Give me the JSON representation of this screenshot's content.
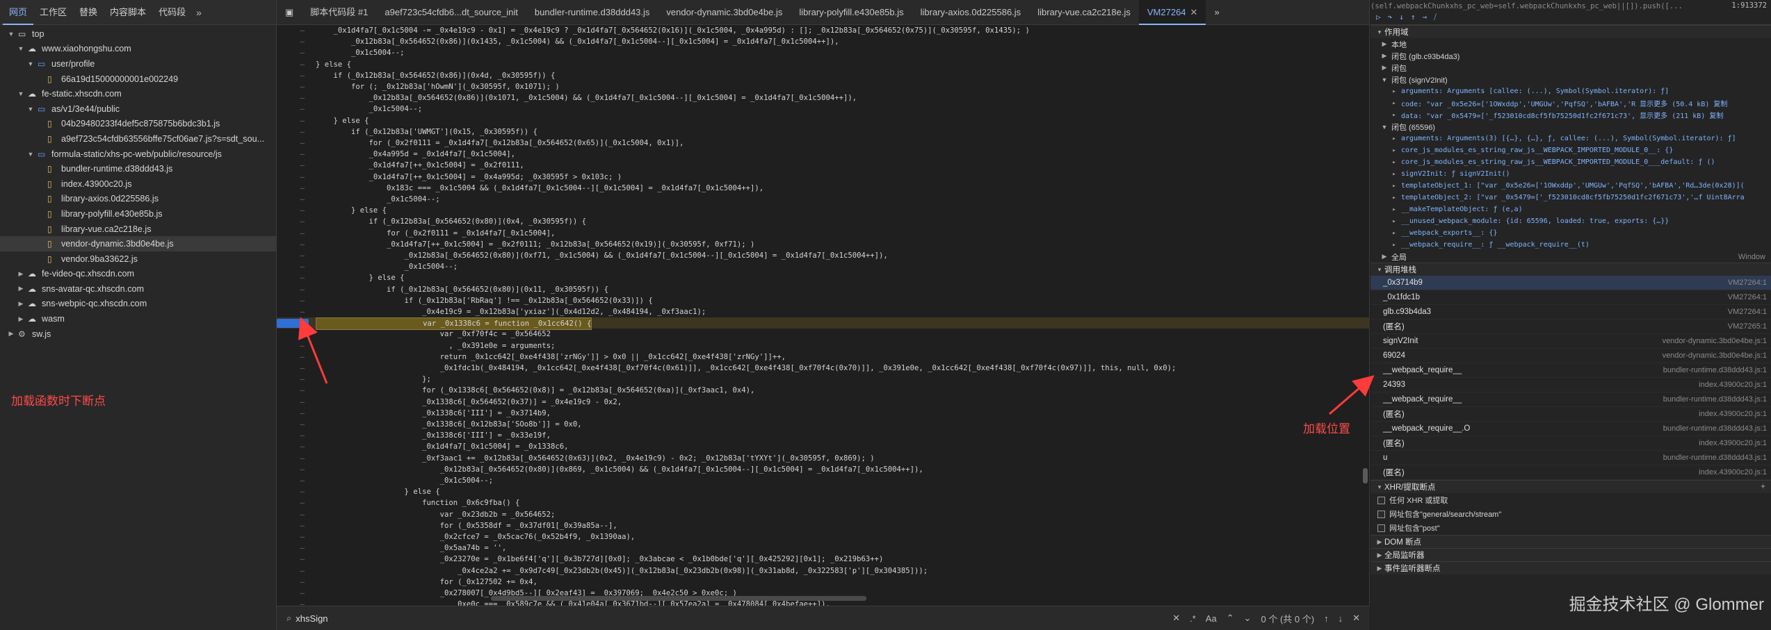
{
  "left": {
    "tabs": [
      "网页",
      "工作区",
      "替换",
      "内容脚本",
      "代码段"
    ],
    "active_tab": "网页",
    "tree": [
      {
        "label": "top",
        "depth": 0,
        "icon": "frame-icon",
        "expand": "down"
      },
      {
        "label": "www.xiaohongshu.com",
        "depth": 1,
        "icon": "cloud-icon",
        "expand": "down"
      },
      {
        "label": "user/profile",
        "depth": 2,
        "icon": "folder-icon",
        "expand": "down"
      },
      {
        "label": "66a19d15000000001e002249",
        "depth": 3,
        "icon": "file-icon",
        "expand": ""
      },
      {
        "label": "fe-static.xhscdn.com",
        "depth": 1,
        "icon": "cloud-icon",
        "expand": "down"
      },
      {
        "label": "as/v1/3e44/public",
        "depth": 2,
        "icon": "folder-icon",
        "expand": "down"
      },
      {
        "label": "04b29480233f4def5c875875b6bdc3b1.js",
        "depth": 3,
        "icon": "file-icon",
        "expand": ""
      },
      {
        "label": "a9ef723c54cfdb63556bffe75cf06ae7.js?s=sdt_sou...",
        "depth": 3,
        "icon": "file-icon",
        "expand": ""
      },
      {
        "label": "formula-static/xhs-pc-web/public/resource/js",
        "depth": 2,
        "icon": "folder-icon",
        "expand": "down"
      },
      {
        "label": "bundler-runtime.d38ddd43.js",
        "depth": 3,
        "icon": "file-icon",
        "expand": ""
      },
      {
        "label": "index.43900c20.js",
        "depth": 3,
        "icon": "file-icon",
        "expand": ""
      },
      {
        "label": "library-axios.0d225586.js",
        "depth": 3,
        "icon": "file-icon",
        "expand": ""
      },
      {
        "label": "library-polyfill.e430e85b.js",
        "depth": 3,
        "icon": "file-icon",
        "expand": ""
      },
      {
        "label": "library-vue.ca2c218e.js",
        "depth": 3,
        "icon": "file-icon",
        "expand": ""
      },
      {
        "label": "vendor-dynamic.3bd0e4be.js",
        "depth": 3,
        "icon": "file-icon",
        "expand": "",
        "selected": true
      },
      {
        "label": "vendor.9ba33622.js",
        "depth": 3,
        "icon": "file-icon",
        "expand": ""
      },
      {
        "label": "fe-video-qc.xhscdn.com",
        "depth": 1,
        "icon": "cloud-icon",
        "expand": "right"
      },
      {
        "label": "sns-avatar-qc.xhscdn.com",
        "depth": 1,
        "icon": "cloud-icon",
        "expand": "right"
      },
      {
        "label": "sns-webpic-qc.xhscdn.com",
        "depth": 1,
        "icon": "cloud-icon",
        "expand": "right"
      },
      {
        "label": "wasm",
        "depth": 1,
        "icon": "cloud-icon",
        "expand": "right"
      },
      {
        "label": "sw.js",
        "depth": 0,
        "icon": "gear-icon",
        "expand": "right"
      }
    ]
  },
  "editor": {
    "tabs": [
      {
        "label": "脚本代码段 #1",
        "active": false
      },
      {
        "label": "a9ef723c54cfdb6...dt_source_init",
        "active": false
      },
      {
        "label": "bundler-runtime.d38ddd43.js",
        "active": false
      },
      {
        "label": "vendor-dynamic.3bd0e4be.js",
        "active": false
      },
      {
        "label": "library-polyfill.e430e85b.js",
        "active": false
      },
      {
        "label": "library-axios.0d225586.js",
        "active": false
      },
      {
        "label": "library-vue.ca2c218e.js",
        "active": false
      },
      {
        "label": "VM27264",
        "active": true
      }
    ],
    "more_tabs": "»",
    "code": [
      "    _0x1d4fa7[_0x1c5004 -= _0x4e19c9 - 0x1] = _0x4e19c9 ? _0x1d4fa7[_0x564652(0x16)](_0x1c5004, _0x4a995d) : []; _0x12b83a[_0x564652(0x75)](_0x30595f, 0x1435); )",
      "        _0x12b83a[_0x564652(0x86)](0x1435, _0x1c5004) && (_0x1d4fa7[_0x1c5004--][_0x1c5004] = _0x1d4fa7[_0x1c5004++]),",
      "        _0x1c5004--;",
      "} else {",
      "    if (_0x12b83a[_0x564652(0x86)](0x4d, _0x30595f)) {",
      "        for (; _0x12b83a['hOwmN'](_0x30595f, 0x1071); )",
      "            _0x12b83a[_0x564652(0x86)](0x1071, _0x1c5004) && (_0x1d4fa7[_0x1c5004--][_0x1c5004] = _0x1d4fa7[_0x1c5004++]),",
      "            _0x1c5004--;",
      "    } else {",
      "        if (_0x12b83a['UWMGT'](0x15, _0x30595f)) {",
      "            for (_0x2f0111 = _0x1d4fa7[_0x12b83a[_0x564652(0x65)](_0x1c5004, 0x1)],",
      "            _0x4a995d = _0x1d4fa7[_0x1c5004],",
      "            _0x1d4fa7[++_0x1c5004] = _0x2f0111,",
      "            _0x1d4fa7[++_0x1c5004] = _0x4a995d; _0x30595f > 0x103c; )",
      "                0x183c === _0x1c5004 && (_0x1d4fa7[_0x1c5004--][_0x1c5004] = _0x1d4fa7[_0x1c5004++]),",
      "                _0x1c5004--;",
      "        } else {",
      "            if (_0x12b83a[_0x564652(0x80)](0x4, _0x30595f)) {",
      "                for (_0x2f0111 = _0x1d4fa7[_0x1c5004],",
      "                _0x1d4fa7[++_0x1c5004] = _0x2f0111; _0x12b83a[_0x564652(0x19)](_0x30595f, 0xf71); )",
      "                    _0x12b83a[_0x564652(0x80)](0xf71, _0x1c5004) && (_0x1d4fa7[_0x1c5004--][_0x1c5004] = _0x1d4fa7[_0x1c5004++]),",
      "                    _0x1c5004--;",
      "            } else {",
      "                if (_0x12b83a[_0x564652(0x80)](0x11, _0x30595f)) {",
      "                    if (_0x12b83a['RbRaq'] !== _0x12b83a[_0x564652(0x33)]) {",
      "                        _0x4e19c9 = _0x12b83a['yxiaz'](_0x4d12d2, _0x484194, _0xf3aac1);",
      "                        var _0x1338c6 = function _0x1cc642() {",
      "                            var _0xf70f4c = _0x564652",
      "                              , _0x391e0e = arguments;",
      "                            return _0x1cc642[_0xe4f438['zrNGy']] > 0x0 || _0x1cc642[_0xe4f438['zrNGy']]++,",
      "                            _0x1fdc1b(_0x484194, _0x1cc642[_0xe4f438[_0xf70f4c(0x61)]], _0x1cc642[_0xe4f438[_0xf70f4c(0x70)]], _0x391e0e, _0x1cc642[_0xe4f438[_0xf70f4c(0x97)]], this, null, 0x0);",
      "                        };",
      "                        for (_0x1338c6[_0x564652(0x8)] = _0x12b83a[_0x564652(0xa)](_0xf3aac1, 0x4),",
      "                        _0x1338c6[_0x564652(0x37)] = _0x4e19c9 - 0x2,",
      "                        _0x1338c6['III'] = _0x3714b9,",
      "                        _0x1338c6[_0x12b83a['SOo8b']] = 0x0,",
      "                        _0x1338c6['III'] = _0x33e19f,",
      "                        _0x1d4fa7[_0x1c5004] = _0x1338c6,",
      "                        _0xf3aac1 += _0x12b83a[_0x564652(0x63)](0x2, _0x4e19c9) - 0x2; _0x12b83a['tYXYt'](_0x30595f, 0x869); )",
      "                            _0x12b83a[_0x564652(0x80)](0x869, _0x1c5004) && (_0x1d4fa7[_0x1c5004--][_0x1c5004] = _0x1d4fa7[_0x1c5004++]),",
      "                            _0x1c5004--;",
      "                    } else {",
      "                        function _0x6c9fba() {",
      "                            var _0x23db2b = _0x564652;",
      "                            for (_0x5358df = _0x37df01[_0x39a85a--],",
      "                            _0x2cfce7 = _0x5cac76(_0x52b4f9, _0x1390aa),",
      "                            _0x5aa74b = '',",
      "                            _0x23270e = _0x1be6f4['q'][_0x3b727d][0x0]; _0x3abcae < _0x1b0bde['q'][_0x425292][0x1]; _0x219b63++)",
      "                                _0x4ce2a2 += _0x9d7c49[_0x23db2b(0x45)](_0x12b83a[_0x23db2b(0x98)](_0x31ab8d, _0x322583['p'][_0x304385]));",
      "                            for (_0x127502 += 0x4,",
      "                            _0x278007[_0x4d9bd5--][_0x2eaf43] = _0x397069; _0x4e2c50 > 0xe0c; )",
      "                                0xe0c === _0x589c7e && (_0x41e04a[_0x3671bd--][_0x57ea2a] = _0x478084[_0x4befae++]),",
      "                                _0x22dc14--;"
    ],
    "highlight_line": 26,
    "breakpoint_line": 26,
    "search": {
      "query": "xhsSign",
      "match_case": "Aa",
      "regex": ".*",
      "count": "0 个 (共 0 个)"
    }
  },
  "annotations": {
    "left": "加载函数时下断点",
    "right": "加载位置"
  },
  "right": {
    "top_source": "(self.webpackChunkxhs_pc_web=self.webpackChunkxhs_pc_web||[]).push([...",
    "line_col": "1:913372",
    "scope_header": "作用域",
    "scope_items": [
      {
        "label": "本地",
        "depth": 1,
        "expand": "right"
      },
      {
        "label": "闭包 (glb.c93b4da3)",
        "depth": 1,
        "expand": "right"
      },
      {
        "label": "闭包",
        "depth": 1,
        "expand": "right"
      },
      {
        "label": "闭包 (signV2Init)",
        "depth": 1,
        "expand": "down"
      },
      {
        "label": "arguments: Arguments [callee: (...), Symbol(Symbol.iterator): ƒ]",
        "depth": 2,
        "mono": true
      },
      {
        "label": "code: \"var _0x5e26=['1OWxddp','UMGUw','PqfSQ','bAFBA','R 显示更多 (50.4 kB)  复制",
        "depth": 2,
        "mono": true
      },
      {
        "label": "data: \"var _0x5479=['_f523010cd8cf5fb75250d1fc2f671c73', 显示更多 (211 kB)  复制",
        "depth": 2,
        "mono": true
      },
      {
        "label": "闭包 (65596)",
        "depth": 1,
        "expand": "down"
      },
      {
        "label": "arguments: Arguments(3) [{…}, {…}, ƒ, callee: (...), Symbol(Symbol.iterator): ƒ]",
        "depth": 2,
        "mono": true
      },
      {
        "label": "core_js_modules_es_string_raw_js__WEBPACK_IMPORTED_MODULE_0__: {}",
        "depth": 2,
        "mono": true
      },
      {
        "label": "core_js_modules_es_string_raw_js__WEBPACK_IMPORTED_MODULE_0___default: ƒ ()",
        "depth": 2,
        "mono": true
      },
      {
        "label": "signV2Init: ƒ signV2Init()",
        "depth": 2,
        "mono": true
      },
      {
        "label": "templateObject_1: [\"var _0x5e26=['1OWxddp','UMGUw','PqfSQ','bAFBA','Rd…3de(0x28)](",
        "depth": 2,
        "mono": true
      },
      {
        "label": "templateObject_2: [\"var _0x5479=['_f523010cd8cf5fb75250d1fc2f671c73','…f Uint8Arra",
        "depth": 2,
        "mono": true
      },
      {
        "label": "__makeTemplateObject: ƒ (e,a)",
        "depth": 2,
        "mono": true
      },
      {
        "label": "__unused_webpack_module: {id: 65596, loaded: true, exports: {…}}",
        "depth": 2,
        "mono": true
      },
      {
        "label": "__webpack_exports__: {}",
        "depth": 2,
        "mono": true
      },
      {
        "label": "__webpack_require__: ƒ __webpack_require__(t)",
        "depth": 2,
        "mono": true
      },
      {
        "label": "全局",
        "depth": 1,
        "expand": "right",
        "extra": "Window"
      }
    ],
    "callstack_header": "调用堆栈",
    "callstack": [
      {
        "fn": "_0x3714b9",
        "loc": "VM27264:1",
        "current": true
      },
      {
        "fn": "_0x1fdc1b",
        "loc": "VM27264:1",
        "current": false
      },
      {
        "fn": "glb.c93b4da3",
        "loc": "VM27264:1",
        "current": false
      },
      {
        "fn": "(匿名)",
        "loc": "VM27265:1",
        "current": false
      },
      {
        "fn": "signV2Init",
        "loc": "vendor-dynamic.3bd0e4be.js:1",
        "current": false
      },
      {
        "fn": "69024",
        "loc": "vendor-dynamic.3bd0e4be.js:1",
        "current": false
      },
      {
        "fn": "__webpack_require__",
        "loc": "bundler-runtime.d38ddd43.js:1",
        "current": false
      },
      {
        "fn": "24393",
        "loc": "index.43900c20.js:1",
        "current": false
      },
      {
        "fn": "__webpack_require__",
        "loc": "bundler-runtime.d38ddd43.js:1",
        "current": false
      },
      {
        "fn": "(匿名)",
        "loc": "index.43900c20.js:1",
        "current": false
      },
      {
        "fn": "__webpack_require__.O",
        "loc": "bundler-runtime.d38ddd43.js:1",
        "current": false
      },
      {
        "fn": "(匿名)",
        "loc": "index.43900c20.js:1",
        "current": false
      },
      {
        "fn": "u",
        "loc": "bundler-runtime.d38ddd43.js:1",
        "current": false
      },
      {
        "fn": "(匿名)",
        "loc": "index.43900c20.js:1",
        "current": false
      }
    ],
    "xhr_header": "XHR/提取断点",
    "xhr_items": [
      "任何 XHR 或提取",
      "网址包含\"general/search/stream\"",
      "网址包含\"post\""
    ],
    "more_sections": [
      "DOM 断点",
      "全局监听器",
      "事件监听器断点"
    ]
  },
  "watermark": "掘金技术社区 @ Glommer"
}
